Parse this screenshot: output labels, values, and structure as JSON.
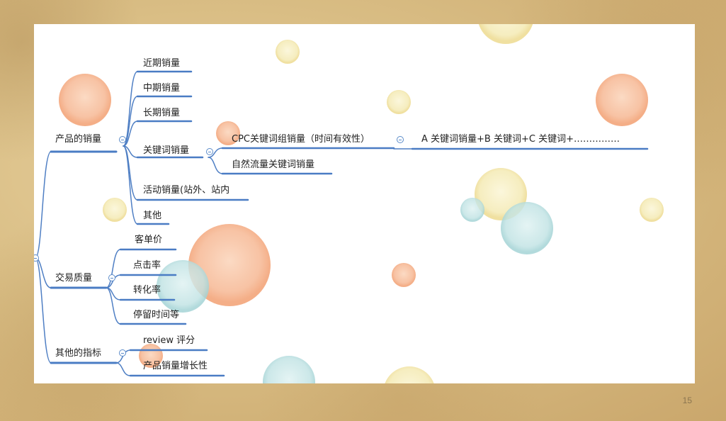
{
  "mindmap": {
    "branches": [
      {
        "label": "产品的销量",
        "children": [
          {
            "label": "近期销量"
          },
          {
            "label": "中期销量"
          },
          {
            "label": "长期销量"
          },
          {
            "label": "关键词销量",
            "children": [
              {
                "label": "CPC关键词组销量（时间有效性）",
                "children": [
                  {
                    "label": "A 关键词销量+B 关键词+C 关键词+……………"
                  }
                ]
              },
              {
                "label": "自然流量关键词销量"
              }
            ]
          },
          {
            "label": "活动销量(站外、站内"
          },
          {
            "label": "其他"
          }
        ]
      },
      {
        "label": "交易质量",
        "children": [
          {
            "label": "客单价"
          },
          {
            "label": "点击率"
          },
          {
            "label": "转化率"
          },
          {
            "label": "停留时间等"
          }
        ]
      },
      {
        "label": "其他的指标",
        "children": [
          {
            "label": "review 评分"
          },
          {
            "label": "产品销量增长性"
          }
        ]
      }
    ]
  },
  "page_number": "15",
  "colors": {
    "branch_line": "#4f7fc4",
    "underline": "#4a7cc4"
  }
}
